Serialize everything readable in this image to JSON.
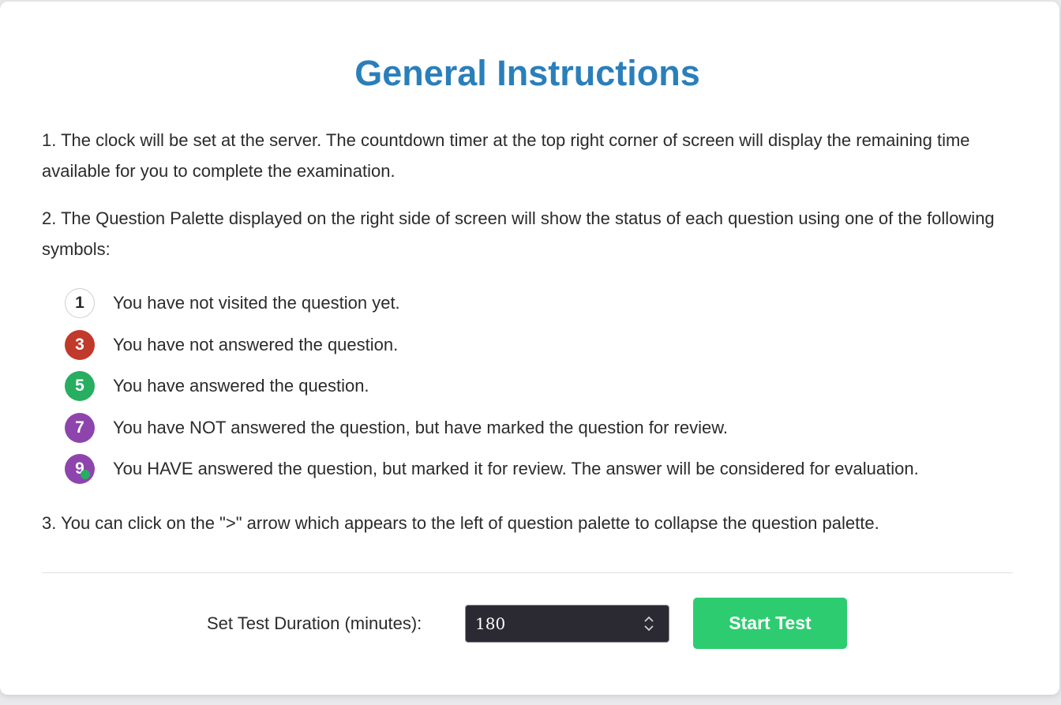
{
  "title": "General Instructions",
  "instructions": {
    "item1": "1. The clock will be set at the server. The countdown timer at the top right corner of screen will display the remaining time available for you to complete the examination.",
    "item2": "2. The Question Palette displayed on the right side of screen will show the status of each question using one of the following symbols:",
    "item3": "3. You can click on the \">\" arrow which appears to the left of question palette to collapse the question palette."
  },
  "legend": [
    {
      "number": "1",
      "text": "You have not visited the question yet.",
      "status": "not-visited",
      "color": "#ffffff"
    },
    {
      "number": "3",
      "text": "You have not answered the question.",
      "status": "not-answered",
      "color": "#c0392b"
    },
    {
      "number": "5",
      "text": "You have answered the question.",
      "status": "answered",
      "color": "#27ae60"
    },
    {
      "number": "7",
      "text": "You have NOT answered the question, but have marked the question for review.",
      "status": "marked-for-review",
      "color": "#8e44ad"
    },
    {
      "number": "9",
      "text": "You HAVE answered the question, but marked it for review. The answer will be considered for evaluation.",
      "status": "answered-and-marked",
      "color": "#8e44ad",
      "dot_color": "#27ae60"
    }
  ],
  "duration": {
    "label": "Set Test Duration (minutes):",
    "value": "180"
  },
  "start_button": {
    "label": "Start Test"
  },
  "colors": {
    "title": "#2a7fba",
    "start_button": "#2ecc71",
    "input_background": "#2b2a33"
  }
}
